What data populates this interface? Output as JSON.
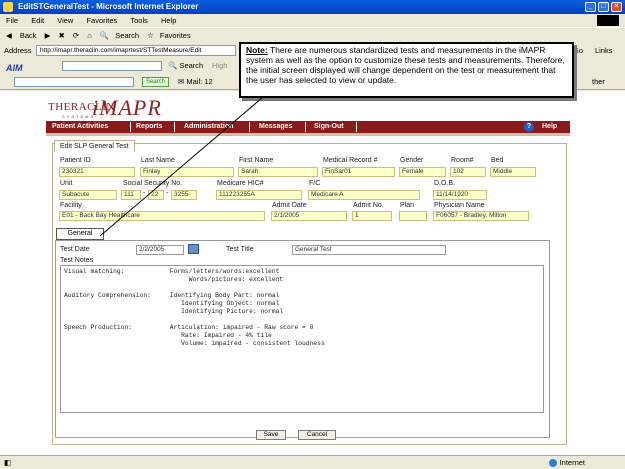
{
  "window": {
    "title": "EditSTGeneralTest - Microsoft Internet Explorer",
    "buttons": [
      "_",
      "□",
      "×"
    ]
  },
  "menu": [
    "File",
    "Edit",
    "View",
    "Favorites",
    "Tools",
    "Help"
  ],
  "toolbar": {
    "back": "Back",
    "search": "Search",
    "favorites": "Favorites"
  },
  "address": {
    "label": "Address",
    "url": "http://imapr.theraclin.com/imaprtest/STTestMeasure/Edit",
    "go": "Go",
    "links": "Links"
  },
  "linksbar": {
    "aim": "AIM",
    "search": "Search",
    "high": "High",
    "search_btn": "Search",
    "mail": "Mail: 12",
    "other": "ther"
  },
  "logo": {
    "thera": "THERACLIN",
    "systems": "SYSTEMS",
    "imapr": "iMAPR"
  },
  "nav": {
    "items": [
      "Patient Activities",
      "Reports",
      "Administration",
      "Messages",
      "Sign-Out"
    ],
    "help": "Help",
    "help_icon": "?"
  },
  "form": {
    "tab": "Edit SLP General Test",
    "row1": {
      "labels": [
        "Patient ID",
        "Last Name",
        "First Name",
        "Medical Record #",
        "Gender",
        "Room#",
        "Bed"
      ],
      "values": [
        "230321",
        "Finlay",
        "Sarah",
        "FinSar01",
        "Female",
        "102",
        "Middle"
      ]
    },
    "row2": {
      "labels": [
        "Unit",
        "Social Security No.",
        "Medicare HIC#",
        "F/C",
        "D.O.B."
      ],
      "ssn": [
        "111",
        "22",
        "3255"
      ],
      "values": [
        "Subacute",
        "111223255A",
        "Medicare A",
        "11/14/1920"
      ]
    },
    "row3": {
      "labels": [
        "Facility",
        "Admit Date",
        "Admit No.",
        "Plan",
        "Physician Name"
      ],
      "values": [
        "E01 - Back Bay Healthcare",
        "2/1/2005",
        "1",
        "",
        "F06057 - Bradley, Milton"
      ]
    },
    "general_tab": "General",
    "test_date_label": "Test Date",
    "test_date": "2/2/2005",
    "test_title_label": "Test Title",
    "test_title": "General Test",
    "test_notes_label": "Test Notes",
    "notes": [
      "Visual matching:            Forms/letters/words:excellent",
      "                                 Words/pictures: excellent",
      "",
      "Auditory Comprehension:     Identifying Body Part: normal",
      "                               Identifying Object: normal",
      "                               Identifying Picture: normal",
      "",
      "Speech Production:          Articulation: impaired - Raw score = 8",
      "                               Rate: Impaired - 4% tile",
      "                               Volume: impaired - consistent loudness"
    ],
    "save": "Save",
    "cancel": "Cancel"
  },
  "callout": {
    "label": "Note:",
    "text": "There are numerous standardized tests and measurements in the iMAPR system as well as the option to customize these tests and measurements. Therefore, the initial screen displayed will change dependent on the test or measurement that the user has selected to view or update."
  },
  "status": {
    "zone": "Internet"
  }
}
